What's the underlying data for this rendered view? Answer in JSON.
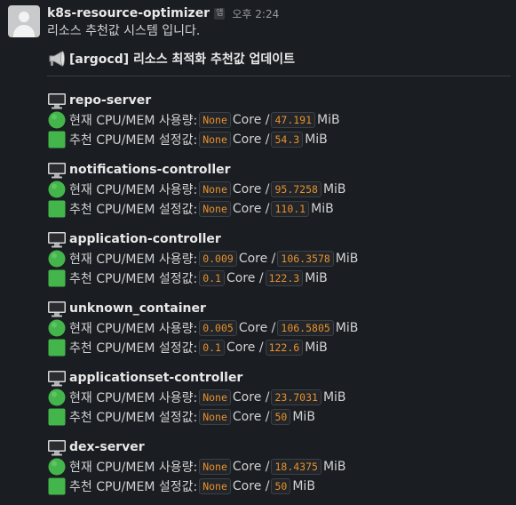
{
  "message": {
    "sender": "k8s-resource-optimizer",
    "app_badge": "앱",
    "timestamp": "오후 2:24",
    "intro_text": "리소스 추천값 시스템 입니다.",
    "announcement": "[argocd] 리소스 최적화 추천값 업데이트"
  },
  "labels": {
    "current": "현재 CPU/MEM 사용량:",
    "recommended": "추천 CPU/MEM 설정값:",
    "cpu_unit": "Core /",
    "mem_unit": "MiB"
  },
  "containers": [
    {
      "name": "repo-server",
      "current_cpu": "None",
      "current_mem": "47.191",
      "rec_cpu": "None",
      "rec_mem": "54.3"
    },
    {
      "name": "notifications-controller",
      "current_cpu": "None",
      "current_mem": "95.7258",
      "rec_cpu": "None",
      "rec_mem": "110.1"
    },
    {
      "name": "application-controller",
      "current_cpu": "0.009",
      "current_mem": "106.3578",
      "rec_cpu": "0.1",
      "rec_mem": "122.3"
    },
    {
      "name": "unknown_container",
      "current_cpu": "0.005",
      "current_mem": "106.5805",
      "rec_cpu": "0.1",
      "rec_mem": "122.6"
    },
    {
      "name": "applicationset-controller",
      "current_cpu": "None",
      "current_mem": "23.7031",
      "rec_cpu": "None",
      "rec_mem": "50"
    },
    {
      "name": "dex-server",
      "current_cpu": "None",
      "current_mem": "18.4375",
      "rec_cpu": "None",
      "rec_mem": "50"
    }
  ],
  "icons": {
    "avatar": "user-avatar-icon",
    "announcement": "megaphone-icon",
    "container": "desktop-computer-icon",
    "current": "green-circle-icon",
    "recommended": "green-square-icon"
  },
  "colors": {
    "background": "#1a1d21",
    "code_text": "#e8912d",
    "green": "#43b54b"
  }
}
